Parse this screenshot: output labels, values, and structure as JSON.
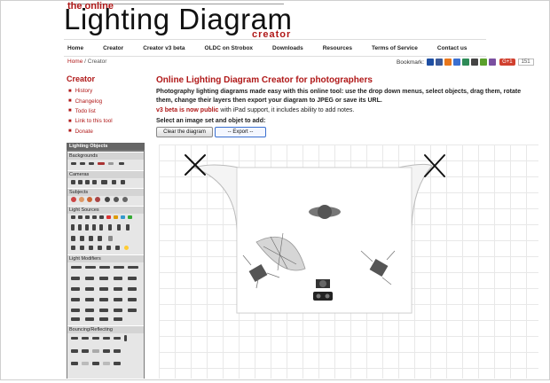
{
  "header": {
    "logo_small": "the online",
    "logo_main": "Lighting Diagram",
    "logo_sub": "creator"
  },
  "nav": [
    {
      "label": "Home"
    },
    {
      "label": "Creator"
    },
    {
      "label": "Creator v3 beta"
    },
    {
      "label": "OLDC on Strobox"
    },
    {
      "label": "Downloads"
    },
    {
      "label": "Resources"
    },
    {
      "label": "Terms of Service"
    },
    {
      "label": "Contact us"
    }
  ],
  "breadcrumb": {
    "home": "Home",
    "separator": " / ",
    "current": "Creator"
  },
  "bookmark": {
    "label": "Bookmark:",
    "gplus": "G+1",
    "count": "151",
    "icon_colors": [
      "#1e4fa3",
      "#3b5998",
      "#e8771c",
      "#3a6fd0",
      "#2e8b57",
      "#444444",
      "#5aa02c",
      "#7a4fa0"
    ]
  },
  "sidebar": {
    "title": "Creator",
    "links": [
      {
        "label": "History"
      },
      {
        "label": "Changelog"
      },
      {
        "label": "Todo list"
      },
      {
        "label": "Link to this tool"
      },
      {
        "label": "Donate"
      }
    ]
  },
  "objects_panel": {
    "title": "Lighting Objects",
    "sections": [
      "Backgrounds",
      "Cameras",
      "Subjects",
      "Light Sources",
      "Light Modifiers",
      "Bouncing/Reflecting"
    ]
  },
  "main": {
    "title": "Online Lighting Diagram Creator for photographers",
    "description": "Photography lighting diagrams made easy with this online tool: use the drop down menus, select objects, drag them, rotate them, change their layers then export your diagram to JPEG or save its URL.",
    "beta_link": "v3 beta is now public",
    "beta_rest": " with iPad support, it includes ability to add notes.",
    "select_prompt": "Select an image set and objet to add:",
    "clear_button": "Clear the diagram",
    "export_select": "-- Export --"
  },
  "colors": {
    "accent": "#b01818",
    "link": "#b01818",
    "panel": "#777777"
  }
}
